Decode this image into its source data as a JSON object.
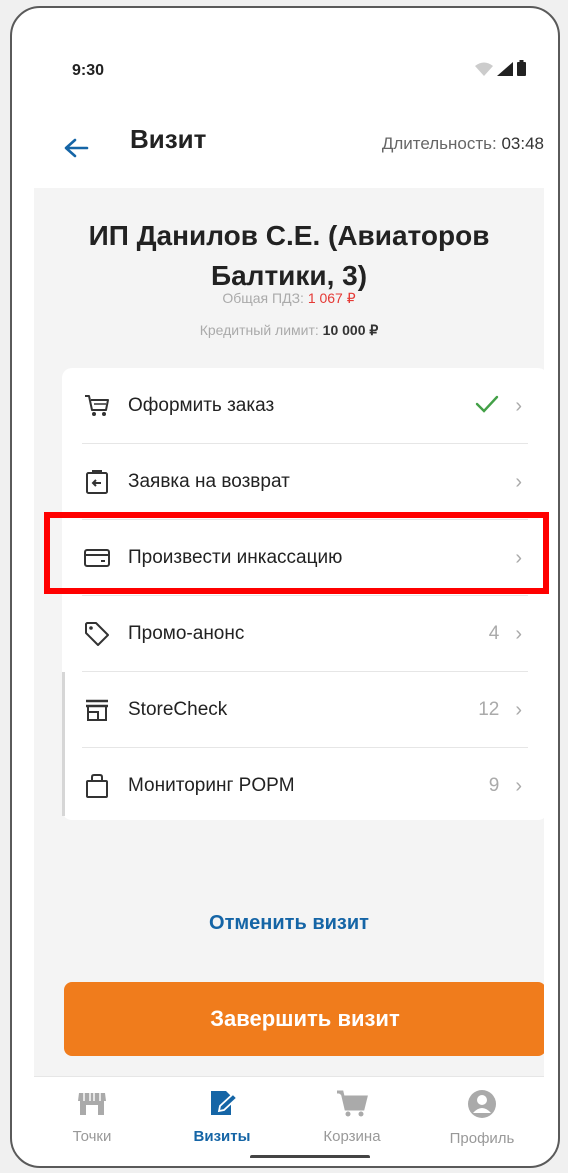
{
  "status": {
    "time": "9:30"
  },
  "appbar": {
    "title": "Визит",
    "duration_label": "Длительность: ",
    "duration_value": "03:48"
  },
  "customer": {
    "name": "ИП Данилов С.Е. (Авиаторов Балтики, 3)",
    "debt_label": "Общая ПДЗ: ",
    "debt_value": "1 067 ₽",
    "credit_label": "Кредитный лимит: ",
    "credit_value": "10 000 ₽"
  },
  "menu": {
    "items": [
      {
        "label": "Оформить заказ",
        "icon": "cart-icon",
        "count": "",
        "done": true
      },
      {
        "label": "Заявка на возврат",
        "icon": "return-icon",
        "count": ""
      },
      {
        "label": "Произвести инкассацию",
        "icon": "card-icon",
        "count": ""
      },
      {
        "label": "Промо-анонс",
        "icon": "tag-icon",
        "count": "4"
      },
      {
        "label": "StoreCheck",
        "icon": "store-icon",
        "count": "12"
      },
      {
        "label": "Мониторинг POPM",
        "icon": "bag-icon",
        "count": "9"
      }
    ]
  },
  "actions": {
    "cancel": "Отменить визит",
    "finish": "Завершить визит"
  },
  "nav": {
    "tabs": [
      {
        "label": "Точки",
        "icon": "store-icon"
      },
      {
        "label": "Визиты",
        "icon": "edit-doc-icon"
      },
      {
        "label": "Корзина",
        "icon": "cart-icon"
      },
      {
        "label": "Профиль",
        "icon": "profile-icon"
      }
    ]
  },
  "colors": {
    "accent": "#1565a6",
    "finish": "#f07c1c",
    "debt": "#e53935",
    "check": "#43a047",
    "highlight": "#ff0000"
  }
}
